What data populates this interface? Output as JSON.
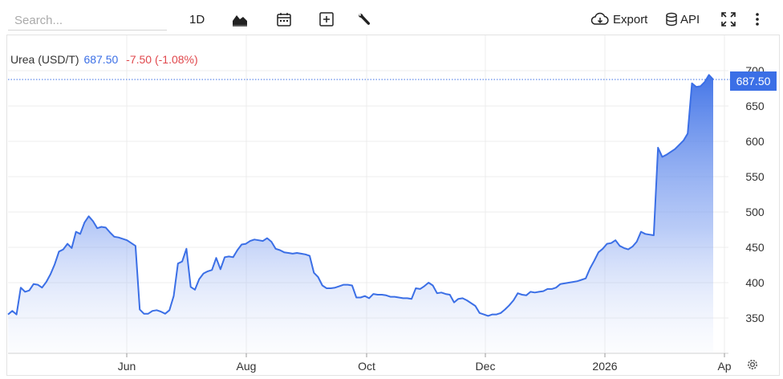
{
  "toolbar": {
    "search_placeholder": "Search...",
    "range_label": "1D",
    "export_label": "Export",
    "api_label": "API"
  },
  "legend": {
    "name": "Urea (USD/T)",
    "price": "687.50",
    "change": "-7.50 (-1.08%)"
  },
  "price_tag": "687.50",
  "colors": {
    "line": "#3b6fe6",
    "negative": "#e0474c",
    "grid": "#ececec"
  },
  "icons": [
    "chart-type-icon",
    "calendar-icon",
    "compare-icon",
    "wrench-icon",
    "cloud-download-icon",
    "database-icon",
    "fullscreen-icon",
    "more-vert-icon",
    "settings-gear-icon"
  ],
  "chart_data": {
    "type": "area",
    "series": [
      {
        "values": [
          355,
          360,
          355,
          393,
          387,
          389,
          398,
          397,
          393,
          401,
          412,
          426,
          444,
          447,
          455,
          449,
          472,
          469,
          485,
          494,
          487,
          477,
          479,
          478,
          471,
          465,
          464,
          462,
          460,
          456,
          452,
          362,
          356,
          356,
          360,
          361,
          359,
          356,
          361,
          381,
          427,
          430,
          448,
          394,
          390,
          405,
          413,
          416,
          418,
          435,
          419,
          436,
          437,
          436,
          446,
          454,
          455,
          459,
          461,
          460,
          459,
          463,
          458,
          448,
          446,
          443,
          442,
          441,
          442,
          441,
          440,
          438,
          414,
          408,
          396,
          392,
          392,
          393,
          395,
          397,
          397,
          396,
          379,
          379,
          381,
          378,
          384,
          383,
          383,
          382,
          380,
          380,
          379,
          378,
          378,
          377,
          392,
          391,
          395,
          400,
          396,
          385,
          386,
          384,
          383,
          372,
          377,
          378,
          375,
          371,
          367,
          357,
          355,
          353,
          355,
          355,
          357,
          362,
          368,
          375,
          385,
          383,
          382,
          387,
          386,
          387,
          388,
          391,
          391,
          393,
          398,
          399,
          400,
          401,
          402,
          404,
          406,
          420,
          431,
          443,
          448,
          455,
          456,
          460,
          452,
          449,
          447,
          451,
          458,
          472,
          469,
          468,
          467,
          591,
          578,
          581,
          585,
          589,
          595,
          601,
          611,
          682,
          677,
          678,
          684,
          694,
          687.5
        ]
      }
    ],
    "x_ticks": [
      "Jun",
      "Aug",
      "Oct",
      "Dec",
      "2026",
      "Ap"
    ],
    "y_ticks": [
      350,
      400,
      450,
      500,
      550,
      600,
      650,
      700
    ],
    "ylim": [
      310,
      700
    ],
    "last_value": 687.5,
    "grid": true
  }
}
